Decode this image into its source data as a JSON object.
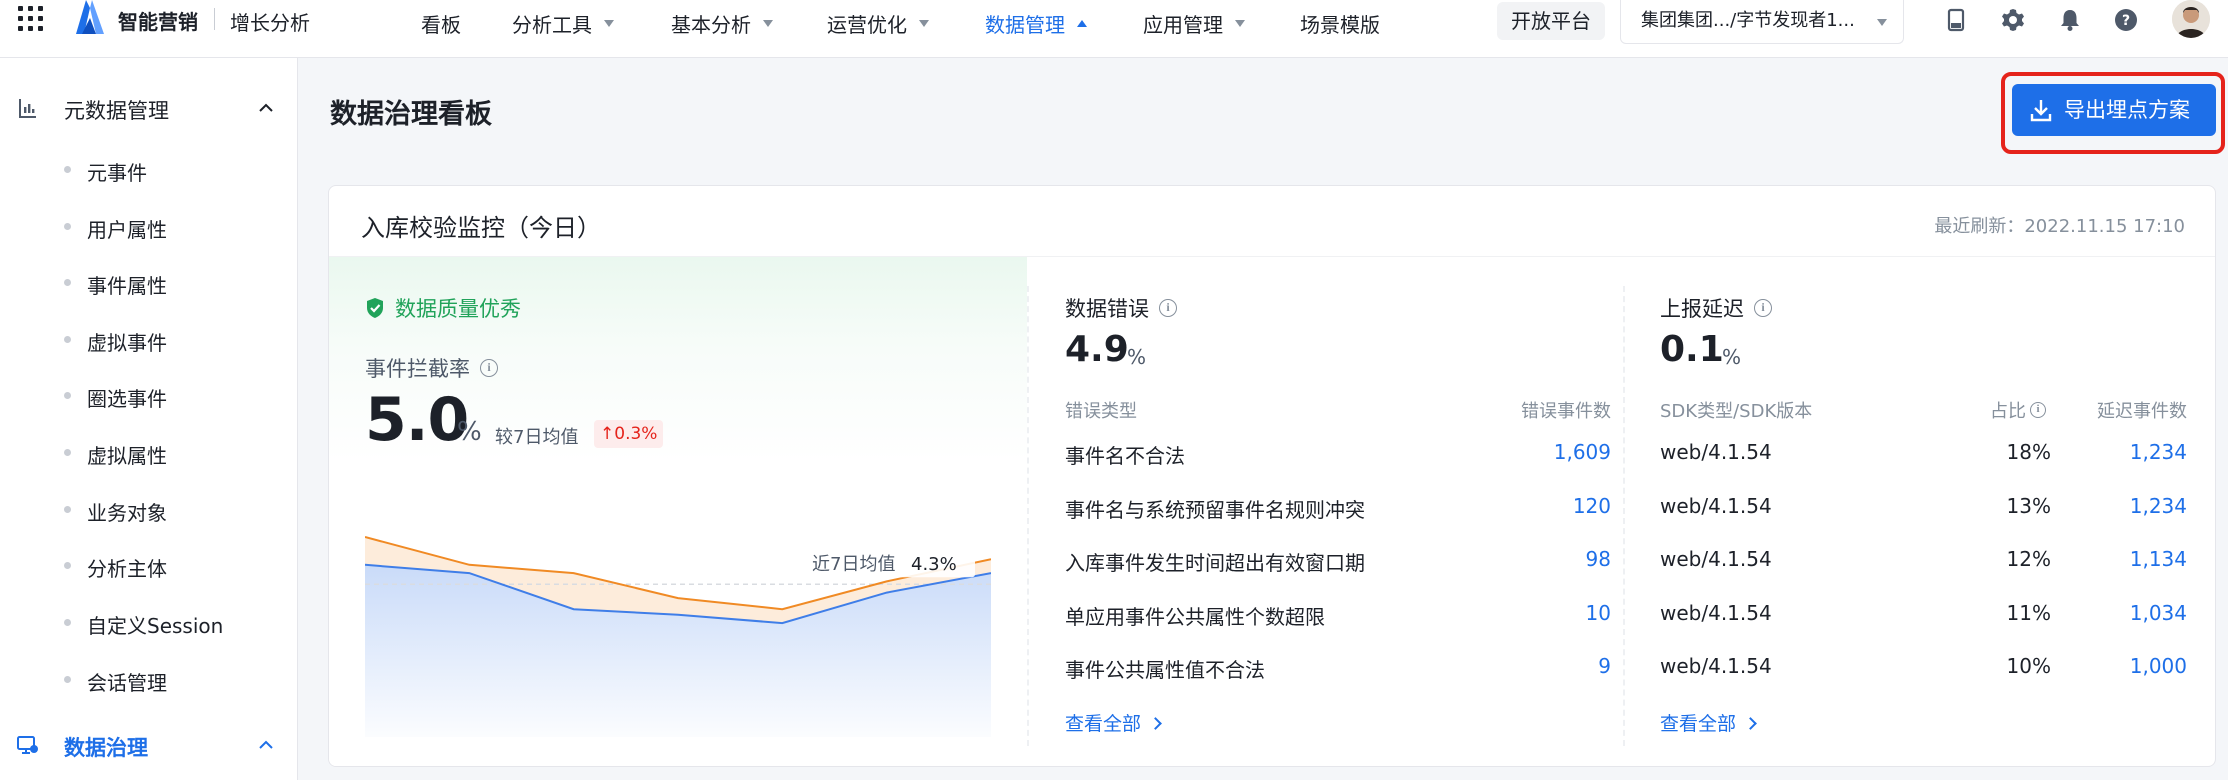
{
  "header": {
    "brand": "智能营销",
    "product": "增长分析",
    "nav": [
      {
        "label": "看板",
        "has_caret": false,
        "active": false
      },
      {
        "label": "分析工具",
        "has_caret": true,
        "active": false
      },
      {
        "label": "基本分析",
        "has_caret": true,
        "active": false
      },
      {
        "label": "运营优化",
        "has_caret": true,
        "active": false
      },
      {
        "label": "数据管理",
        "has_caret": true,
        "active": true
      },
      {
        "label": "应用管理",
        "has_caret": true,
        "active": false
      },
      {
        "label": "场景模版",
        "has_caret": false,
        "active": false
      }
    ],
    "open_platform": "开放平台",
    "project_selector": "集团集团.../字节发现者1...",
    "icons": [
      "tablet-icon",
      "gear-icon",
      "bell-icon",
      "help-icon"
    ]
  },
  "sidebar": {
    "group1": {
      "label": "元数据管理",
      "expanded": true
    },
    "items": [
      "元事件",
      "用户属性",
      "事件属性",
      "虚拟事件",
      "圈选事件",
      "虚拟属性",
      "业务对象",
      "分析主体",
      "自定义Session",
      "会话管理"
    ],
    "group2": {
      "label": "数据治理",
      "expanded": true
    }
  },
  "main": {
    "title": "数据治理看板",
    "export_button": "导出埋点方案",
    "card": {
      "title": "入库校验监控（今日）",
      "refresh_label": "最近刷新：",
      "refresh_time": "2022.11.15 17:10",
      "quality": {
        "badge": "数据质量优秀",
        "metric_label": "事件拦截率",
        "value": "5.0",
        "unit": "%",
        "compare_label": "较7日均值",
        "delta": "0.3%",
        "avg_label": "近7日均值",
        "avg_value": "4.3%"
      },
      "errors": {
        "title": "数据错误",
        "value": "4.9",
        "unit": "%",
        "col_type": "错误类型",
        "col_count": "错误事件数",
        "rows": [
          {
            "type": "事件名不合法",
            "count": "1,609"
          },
          {
            "type": "事件名与系统预留事件名规则冲突",
            "count": "120"
          },
          {
            "type": "入库事件发生时间超出有效窗口期",
            "count": "98"
          },
          {
            "type": "单应用事件公共属性个数超限",
            "count": "10"
          },
          {
            "type": "事件公共属性值不合法",
            "count": "9"
          }
        ],
        "view_all": "查看全部"
      },
      "delay": {
        "title": "上报延迟",
        "value": "0.1",
        "unit": "%",
        "col_sdk": "SDK类型/SDK版本",
        "col_ratio": "占比",
        "col_count": "延迟事件数",
        "rows": [
          {
            "sdk": "web/4.1.54",
            "ratio": "18%",
            "count": "1,234"
          },
          {
            "sdk": "web/4.1.54",
            "ratio": "13%",
            "count": "1,234"
          },
          {
            "sdk": "web/4.1.54",
            "ratio": "12%",
            "count": "1,134"
          },
          {
            "sdk": "web/4.1.54",
            "ratio": "11%",
            "count": "1,034"
          },
          {
            "sdk": "web/4.1.54",
            "ratio": "10%",
            "count": "1,000"
          }
        ],
        "view_all": "查看全部"
      }
    }
  },
  "chart_data": {
    "type": "area",
    "series": [
      {
        "values": [
          7.2,
          6.2,
          5.9,
          5.0,
          4.6,
          5.6,
          6.4
        ],
        "color": "#f08a24"
      },
      {
        "values": [
          6.2,
          5.9,
          4.6,
          4.4,
          4.1,
          5.2,
          5.9
        ],
        "color": "#3f7ee8"
      }
    ],
    "reference_line": 5.5,
    "ylim": [
      0,
      9
    ],
    "colors": {
      "accent": "#1e6fe8",
      "success": "#21a35a",
      "danger": "#e5231b"
    }
  }
}
